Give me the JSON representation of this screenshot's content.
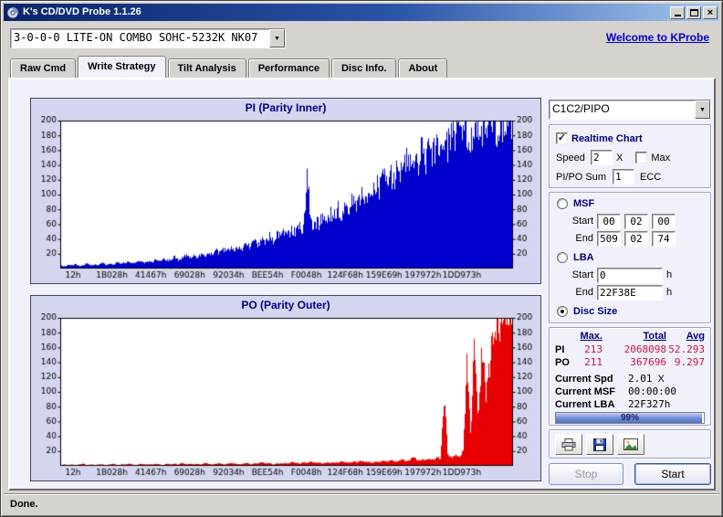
{
  "window": {
    "title": "K's CD/DVD Probe 1.1.26"
  },
  "icons": {
    "dropdown": "▼",
    "check": "✓",
    "close": "×"
  },
  "toolbar": {
    "drive_combo": "3-0-0-0 LITE-ON COMBO SOHC-5232K NK07",
    "welcome_link": "Welcome to KProbe"
  },
  "tabs": {
    "active": "Write Strategy",
    "items": [
      {
        "label": "Raw Cmd"
      },
      {
        "label": "Write Strategy"
      },
      {
        "label": "Tilt Analysis"
      },
      {
        "label": "Performance"
      },
      {
        "label": "Disc Info."
      },
      {
        "label": "About"
      }
    ]
  },
  "chart_data": [
    {
      "type": "area",
      "title": "PI (Parity Inner)",
      "series_color": "#0000cc",
      "ylim": [
        0,
        200
      ],
      "ytick_step": 20,
      "grid": false,
      "xlabel": "",
      "ylabel": "",
      "x_labels": [
        "12h",
        "1B028h",
        "41467h",
        "69028h",
        "92034h",
        "BEE54h",
        "F0048h",
        "124F68h",
        "159E69h",
        "197972h",
        "1DD973h"
      ],
      "values": [
        4,
        3,
        5,
        4,
        6,
        3,
        5,
        7,
        4,
        6,
        5,
        8,
        5,
        7,
        6,
        9,
        7,
        8,
        10,
        7,
        9,
        11,
        8,
        10,
        9,
        12,
        10,
        14,
        11,
        13,
        16,
        12,
        15,
        18,
        14,
        17,
        16,
        20,
        17,
        22,
        19,
        25,
        21,
        27,
        23,
        29,
        26,
        31,
        28,
        34,
        30,
        38,
        33,
        41,
        36,
        45,
        39,
        48,
        43,
        52,
        46,
        55,
        50,
        60,
        54,
        135,
        58,
        66,
        62,
        72,
        67,
        78,
        72,
        84,
        77,
        90,
        83,
        97,
        89,
        104,
        95,
        112,
        101,
        119,
        108,
        126,
        115,
        133,
        122,
        141,
        129,
        149,
        137,
        156,
        144,
        163,
        152,
        170,
        159,
        176,
        166,
        182,
        172,
        188,
        178,
        193,
        184,
        197,
        190,
        200,
        194,
        200,
        197,
        200,
        199,
        200,
        200,
        200,
        200,
        200
      ],
      "noise_seed": 7
    },
    {
      "type": "area",
      "title": "PO (Parity Outer)",
      "series_color": "#e80000",
      "ylim": [
        0,
        200
      ],
      "ytick_step": 20,
      "grid": false,
      "xlabel": "",
      "ylabel": "",
      "x_labels": [
        "12h",
        "1B028h",
        "41467h",
        "69028h",
        "92034h",
        "BEE54h",
        "F0048h",
        "124F68h",
        "159E69h",
        "197972h",
        "1DD973h"
      ],
      "values": [
        1,
        2,
        1,
        2,
        1,
        2,
        3,
        1,
        2,
        1,
        2,
        2,
        1,
        2,
        3,
        1,
        2,
        2,
        3,
        2,
        1,
        3,
        2,
        2,
        2,
        3,
        2,
        1,
        3,
        2,
        3,
        2,
        4,
        2,
        3,
        2,
        3,
        2,
        4,
        3,
        2,
        3,
        4,
        2,
        3,
        4,
        3,
        2,
        3,
        4,
        2,
        4,
        3,
        5,
        3,
        4,
        2,
        4,
        3,
        4,
        3,
        5,
        4,
        3,
        5,
        4,
        6,
        4,
        5,
        3,
        5,
        4,
        5,
        4,
        6,
        5,
        4,
        6,
        5,
        7,
        5,
        6,
        4,
        6,
        5,
        7,
        6,
        8,
        6,
        7,
        9,
        6,
        8,
        12,
        7,
        9,
        8,
        10,
        9,
        12,
        10,
        100,
        14,
        11,
        16,
        13,
        20,
        150,
        35,
        190,
        60,
        170,
        90,
        140,
        200,
        180,
        200,
        195,
        200,
        200
      ],
      "noise_seed": 13
    }
  ],
  "sidebar": {
    "mode_combo": "C1C2/PIPO",
    "realtime_label": "Realtime Chart",
    "realtime_checked": true,
    "speed_label": "Speed",
    "speed_value": "2",
    "speed_unit": "X",
    "max_label": "Max",
    "max_checked": false,
    "pipo_sum_label": "PI/PO Sum",
    "pipo_sum_value": "1",
    "ecc_label": "ECC",
    "msf": {
      "label": "MSF",
      "selected": false,
      "start_label": "Start",
      "start": [
        "00",
        "02",
        "00"
      ],
      "end_label": "End",
      "end": [
        "509",
        "02",
        "74"
      ]
    },
    "lba": {
      "label": "LBA",
      "selected": false,
      "start_label": "Start",
      "start": "0",
      "end_label": "End",
      "end": "22F38E",
      "unit": "h"
    },
    "disc_size": {
      "label": "Disc Size",
      "selected": true
    },
    "stats": {
      "headers": [
        "Max.",
        "Total",
        "Avg"
      ],
      "rows": [
        {
          "name": "PI",
          "max": "213",
          "total": "2068098",
          "avg": "52.293"
        },
        {
          "name": "PO",
          "max": "211",
          "total": "367696",
          "avg": "9.297"
        }
      ]
    },
    "current": {
      "spd_label": "Current Spd",
      "spd_value": "2.01",
      "spd_unit": "X",
      "msf_label": "Current MSF",
      "msf_value": "00:00:00",
      "lba_label": "Current LBA",
      "lba_value": "22F327h"
    },
    "progress": {
      "percent": 99,
      "text": "99%"
    },
    "buttons": {
      "stop": "Stop",
      "start": "Start"
    },
    "icon_buttons": [
      "print",
      "save",
      "export-image"
    ]
  },
  "status_bar": {
    "text": "Done."
  }
}
